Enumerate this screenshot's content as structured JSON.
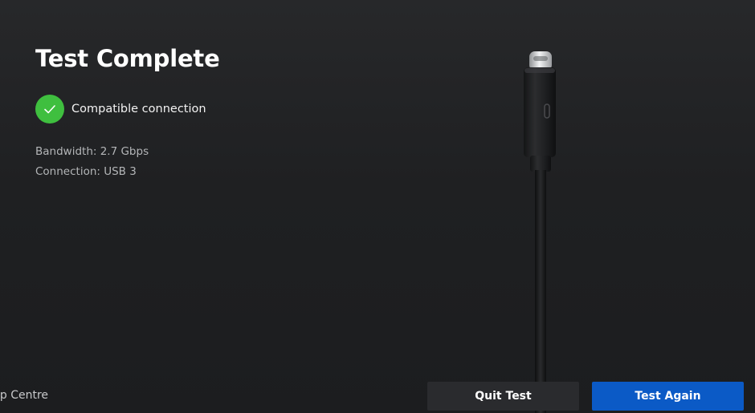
{
  "result": {
    "title": "Test Complete",
    "status_text": "Compatible connection",
    "status_icon": "check-icon",
    "status_color": "#3fbf3f",
    "bandwidth": "Bandwidth: 2.7 Gbps",
    "connection": "Connection: USB 3"
  },
  "illustration": {
    "icon": "usb-c-cable-illustration"
  },
  "footer": {
    "help_link": "lp Centre",
    "quit_label": "Quit Test",
    "again_label": "Test Again",
    "accent_color": "#0b5ac6"
  }
}
